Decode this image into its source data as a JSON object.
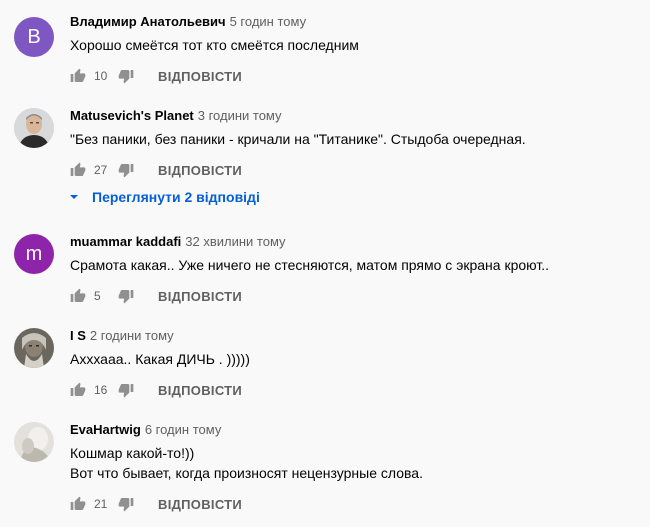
{
  "comments": [
    {
      "author": "Владимир Анатольевич",
      "time": "5 годин тому",
      "text": [
        "Хорошо смеётся тот кто смеётся последним"
      ],
      "likes": "10",
      "reply_label": "ВІДПОВІСТИ",
      "avatar_letter": "B",
      "avatar_color": "#7e57c2"
    },
    {
      "author": "Matusevich's Planet",
      "time": "3 години тому",
      "text": [
        "\"Без паники, без паники - кричали на \"Титанике\". Стыдоба очередная."
      ],
      "likes": "27",
      "reply_label": "ВІДПОВІСТИ"
    },
    {
      "author": "muammar kaddafi",
      "time": "32 хвилини тому",
      "text": [
        "Срамота какая.. Уже ничего не стесняются, матом прямо с экрана кроют.."
      ],
      "likes": "5",
      "reply_label": "ВІДПОВІСТИ",
      "avatar_letter": "m",
      "avatar_color": "#8e24aa"
    },
    {
      "author": "I S",
      "time": "2 години тому",
      "text": [
        "Ахххааа.. Какая ДИЧЬ . )))))"
      ],
      "likes": "16",
      "reply_label": "ВІДПОВІСТИ"
    },
    {
      "author": "EvaHartwig",
      "time": "6 годин тому",
      "text": [
        "Кошмар какой-то!))",
        "Вот что бывает, когда произносят нецензурные слова."
      ],
      "likes": "21",
      "reply_label": "ВІДПОВІСТИ"
    }
  ],
  "view_replies": {
    "label": "Переглянути 2 відповіді",
    "color": "#065fd4"
  },
  "icons": {
    "like": "thumb-up-icon",
    "dislike": "thumb-down-icon",
    "expand": "chevron-down-icon"
  }
}
